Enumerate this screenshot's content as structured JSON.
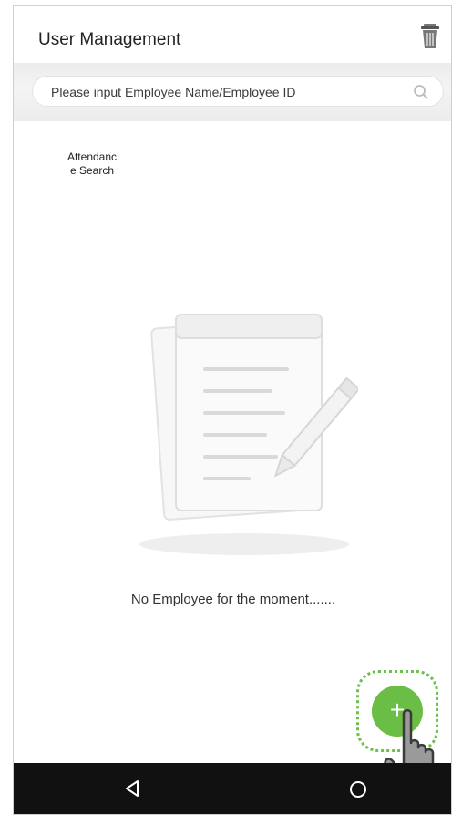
{
  "status_bar": {
    "text": ""
  },
  "header": {
    "title": "User Management",
    "delete_icon": "trash-icon"
  },
  "search": {
    "placeholder": "Please input Employee Name/Employee ID",
    "icon": "search-icon"
  },
  "attendance": {
    "label": "Attendanc\ne Search"
  },
  "empty_state": {
    "message": "No Employee for the moment.......",
    "icon": "document-pencil-icon"
  },
  "fab": {
    "icon": "plus-icon",
    "symbol": "+",
    "accent": "#6abd45"
  },
  "nav": {
    "back_icon": "back-triangle-icon",
    "home_icon": "home-circle-icon"
  },
  "colors": {
    "accent": "#6abd45",
    "nav_bg": "#111111"
  }
}
